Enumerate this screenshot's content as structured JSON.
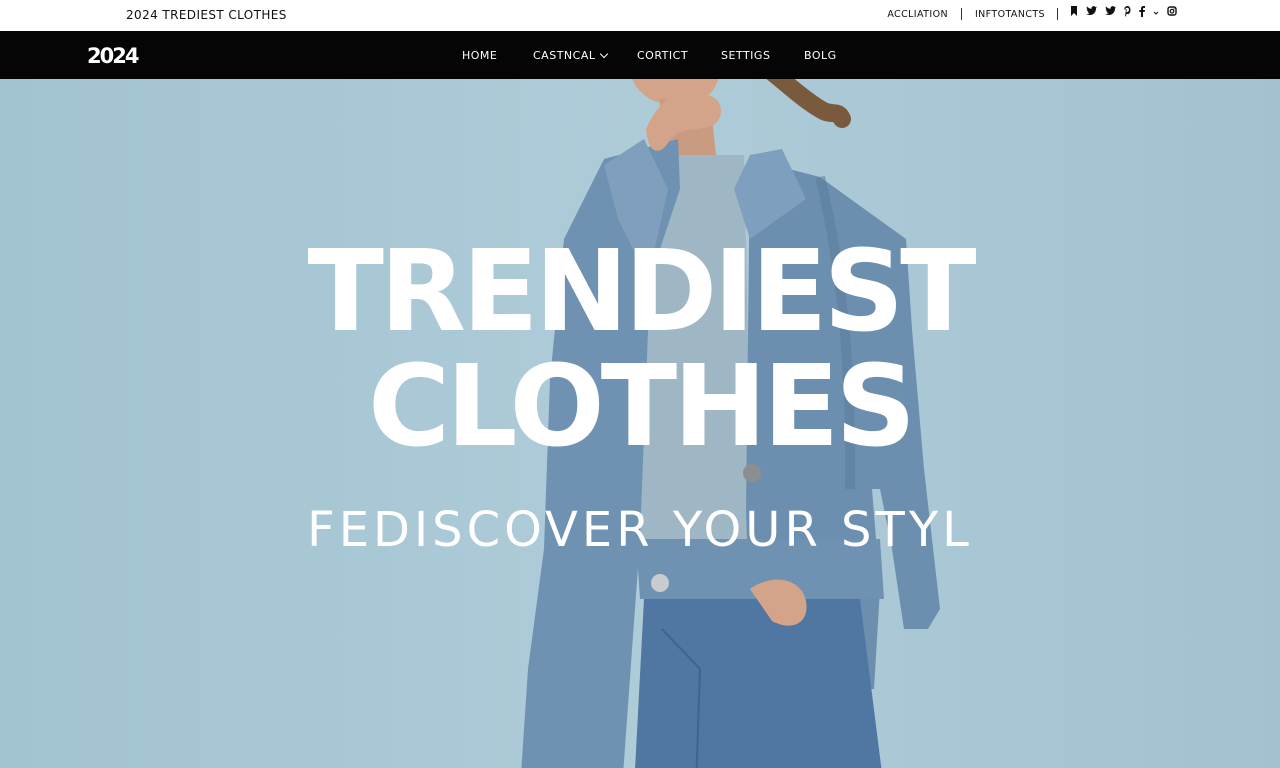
{
  "topbar": {
    "title": "2024 TREDIEST CLOTHES",
    "links": [
      "ACCLIATION",
      "INFTOTANCTS"
    ],
    "social_icons": [
      "bookmark-icon",
      "twitter-icon",
      "twitter-icon",
      "pinterest-icon",
      "facebook-icon",
      "instagram-icon"
    ]
  },
  "navbar": {
    "logo": "2024",
    "items": [
      "HOME",
      "CASTNCAL",
      "CORTICT",
      "SETTIGS",
      "BOLG"
    ]
  },
  "hero": {
    "line1": "TRENDIEST",
    "line2": "CLOTHES",
    "tagline": "FEDISCOVER YOUR STYL"
  },
  "colors": {
    "background": "#a7c6d4",
    "navbar": "#050505",
    "topbar": "#ffffff",
    "denim": "#6f92b2"
  }
}
